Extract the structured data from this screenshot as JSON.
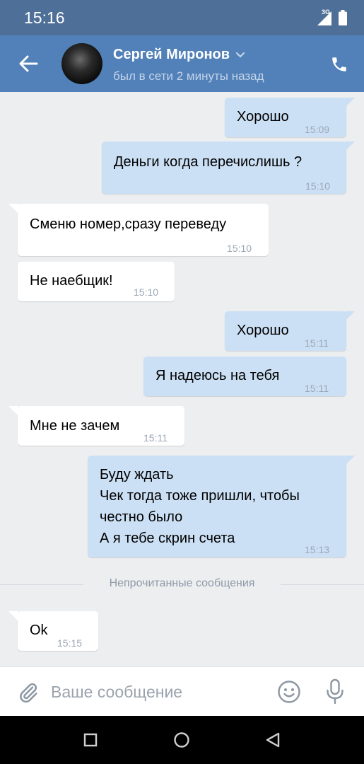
{
  "status_bar": {
    "time": "15:16",
    "network": "3G"
  },
  "header": {
    "name": "Сергей Миронов",
    "status": "был в сети 2 минуты назад"
  },
  "messages": [
    {
      "direction": "out",
      "text": "Хорошо",
      "time": "15:09"
    },
    {
      "direction": "out",
      "text": "Деньги когда перечислишь ?",
      "time": "15:10"
    },
    {
      "direction": "in",
      "text": "Сменю номер,сразу переведу",
      "time": "15:10"
    },
    {
      "direction": "in",
      "text": "Не наебщик!",
      "time": "15:10"
    },
    {
      "direction": "out",
      "text": "Хорошо",
      "time": "15:11"
    },
    {
      "direction": "out",
      "text": "Я надеюсь на тебя",
      "time": "15:11"
    },
    {
      "direction": "in",
      "text": "Мне не зачем",
      "time": "15:11"
    },
    {
      "direction": "out",
      "text": "Буду ждать\nЧек тогда тоже пришли, чтобы\nчестно было\nА я тебе скрин счета",
      "time": "15:13"
    },
    {
      "direction": "in",
      "text": "Ok",
      "time": "15:15"
    }
  ],
  "divider": {
    "label": "Непрочитанные сообщения"
  },
  "composer": {
    "placeholder": "Ваше сообщение"
  },
  "colors": {
    "header": "#5181b8",
    "status_bar": "#4e6f97",
    "outgoing_bubble": "#cce0f5",
    "incoming_bubble": "#ffffff",
    "chat_background": "#edeef0"
  }
}
